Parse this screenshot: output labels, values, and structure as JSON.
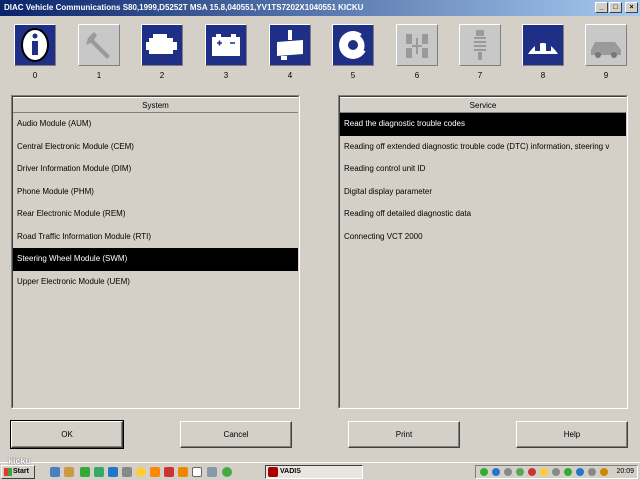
{
  "window": {
    "title": "DIAC  Vehicle Communications  S80,1999,D5252T MSA 15.8,040551,YV1TS7202X1040551 KICKU",
    "minimize_glyph": "_",
    "maximize_glyph": "□",
    "close_glyph": "×"
  },
  "categories": [
    {
      "num": "0",
      "icon": "info-icon",
      "state": "active"
    },
    {
      "num": "1",
      "icon": "wrench-icon",
      "state": "inactive"
    },
    {
      "num": "2",
      "icon": "engine-icon",
      "state": "active"
    },
    {
      "num": "3",
      "icon": "battery-icon",
      "state": "active"
    },
    {
      "num": "4",
      "icon": "transmission-icon",
      "state": "active"
    },
    {
      "num": "5",
      "icon": "brake-disc-icon",
      "state": "active"
    },
    {
      "num": "6",
      "icon": "steering-icon",
      "state": "inactive"
    },
    {
      "num": "7",
      "icon": "suspension-icon",
      "state": "inactive"
    },
    {
      "num": "8",
      "icon": "seats-icon",
      "state": "active"
    },
    {
      "num": "9",
      "icon": "car-icon",
      "state": "inactive"
    }
  ],
  "system_panel": {
    "header": "System",
    "items": [
      "Audio Module (AUM)",
      "Central Electronic Module (CEM)",
      "Driver Information Module (DIM)",
      "Phone Module (PHM)",
      "Rear Electronic Module (REM)",
      "Road Traffic Information Module (RTI)",
      "Steering Wheel Module (SWM)",
      "Upper Electronic Module (UEM)"
    ],
    "selected_index": 6
  },
  "service_panel": {
    "header": "Service",
    "items": [
      "Read the diagnostic trouble codes",
      "Reading off extended diagnostic trouble code (DTC) information, steering v",
      "Reading control unit ID",
      "Digital display parameter",
      "Reading off detailed diagnostic data",
      "Connecting VCT 2000"
    ],
    "selected_index": 0
  },
  "buttons": {
    "ok": "OK",
    "cancel": "Cancel",
    "print": "Print",
    "help": "Help"
  },
  "taskbar": {
    "start_label": "Start",
    "task_label": "VADIS",
    "clock": "20:09",
    "watermark": "kicku"
  },
  "colors": {
    "active_icon_bg": "#1f2f86",
    "inactive_icon_bg": "#c8c8c8",
    "selection_bg": "#000000"
  }
}
